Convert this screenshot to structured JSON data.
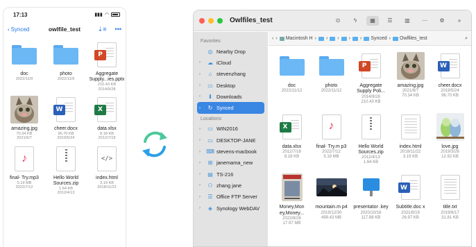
{
  "phone": {
    "status_time": "17:13",
    "back_label": "Synced",
    "title": "owlfile_test",
    "files": [
      {
        "name": "doc",
        "meta": [
          "2022/11/9"
        ],
        "icon": "folder-icon"
      },
      {
        "name": "photo",
        "meta": [
          "2022/11/9"
        ],
        "icon": "folder-icon"
      },
      {
        "name": "Aggregate Supply...ies.pptx",
        "meta": [
          "210.43 KB",
          "2014/9/28"
        ],
        "icon": "powerpoint-icon"
      },
      {
        "name": "amazing.jpg",
        "meta": [
          "70.34 KB",
          "2021/6/7"
        ],
        "icon": "cat-photo-icon"
      },
      {
        "name": "cheer.docx",
        "meta": [
          "96.70 KB",
          "2019/5/24"
        ],
        "icon": "word-icon"
      },
      {
        "name": "data.xlsx",
        "meta": [
          "8.18 KB",
          "2012/7/18"
        ],
        "icon": "excel-icon"
      },
      {
        "name": "final- Try.mp3",
        "meta": [
          "5.19 MB",
          "2022/7/12"
        ],
        "icon": "music-icon"
      },
      {
        "name": "Hello World Sources.zip",
        "meta": [
          "1.64 KB",
          "2012/4/13"
        ],
        "icon": "zip-icon"
      },
      {
        "name": "index.html",
        "meta": [
          "3.19 KB",
          "2018/11/22"
        ],
        "icon": "code-icon"
      }
    ]
  },
  "mac": {
    "window_title": "Owlfiles_test",
    "path": [
      "Macintosh H",
      "",
      "",
      "",
      "",
      "Synced",
      "Owlfiles_test"
    ],
    "sidebar_group_favorites": "Favorites",
    "sidebar_group_locations": "Locations",
    "favorites": [
      {
        "label": "Nearby Drop",
        "icon": "airdrop-icon"
      },
      {
        "label": "iCloud",
        "icon": "cloud-icon",
        "arrow": true
      },
      {
        "label": "stevenzhang",
        "icon": "home-icon",
        "arrow": true
      },
      {
        "label": "Desktop",
        "icon": "desktop-icon",
        "arrow": true
      },
      {
        "label": "Downloads",
        "icon": "download-icon",
        "arrow": true
      },
      {
        "label": "Synced",
        "icon": "sync-icon",
        "arrow": true,
        "active": true
      }
    ],
    "locations": [
      {
        "label": "WIN2016",
        "icon": "monitor-icon",
        "arrow": true
      },
      {
        "label": "DESKTOP-JANE",
        "icon": "monitor-icon",
        "arrow": true
      },
      {
        "label": "stevens-macbook",
        "icon": "laptop-icon",
        "arrow": true
      },
      {
        "label": "janemama_new",
        "icon": "network-icon",
        "arrow": true
      },
      {
        "label": "TS-216",
        "icon": "nas-icon",
        "arrow": true
      },
      {
        "label": "zhang jane",
        "icon": "user-icon",
        "arrow": true
      },
      {
        "label": "Office FTP Server",
        "icon": "server-icon",
        "arrow": true
      },
      {
        "label": "Synology WebDAV",
        "icon": "webdav-icon",
        "arrow": true
      }
    ],
    "files": [
      {
        "name": "doc",
        "meta": [
          "2022/11/12"
        ],
        "icon": "folder-icon"
      },
      {
        "name": "photo",
        "meta": [
          "2022/11/12"
        ],
        "icon": "folder-icon"
      },
      {
        "name": "Aggregate Supply Poli...",
        "meta": [
          "2014/9/28",
          "210.43 KB"
        ],
        "icon": "powerpoint-icon"
      },
      {
        "name": "amazing.jpg",
        "meta": [
          "2021/6/7",
          "70.34 KB"
        ],
        "icon": "cat-photo-icon"
      },
      {
        "name": "cheer.docx",
        "meta": [
          "2019/5/24",
          "96.70 KB"
        ],
        "icon": "word-icon"
      },
      {
        "name": "data.xlsx",
        "meta": [
          "2012/7/18",
          "8.18 KB"
        ],
        "icon": "excel-icon"
      },
      {
        "name": "final- Try.m p3",
        "meta": [
          "2022/7/12",
          "5.19 MB"
        ],
        "icon": "music-icon"
      },
      {
        "name": "Hello World Sources.zip",
        "meta": [
          "2012/4/13",
          "1.64 KB"
        ],
        "icon": "zip-icon"
      },
      {
        "name": "index.html",
        "meta": [
          "2018/11/22",
          "3.19 KB"
        ],
        "icon": "text-doc-icon"
      },
      {
        "name": "love.jpg",
        "meta": [
          "2019/3/26",
          "12.92 KB"
        ],
        "icon": "birds-photo-icon"
      },
      {
        "name": "Money,Mon ey,Money...",
        "meta": [
          "2022/8/26",
          "17.97 MB"
        ],
        "icon": "magazine-icon"
      },
      {
        "name": "mountain.m p4",
        "meta": [
          "2019/12/30",
          "499.43 MB"
        ],
        "icon": "mountain-photo-icon"
      },
      {
        "name": "presentator .key",
        "meta": [
          "2020/10/16",
          "117.88 KB"
        ],
        "icon": "keynote-icon"
      },
      {
        "name": "Subtitle.doc x",
        "meta": [
          "2021/8/19",
          "26.97 KB"
        ],
        "icon": "word-icon"
      },
      {
        "name": "title.txt",
        "meta": [
          "2019/6/17",
          "31.81 KB"
        ],
        "icon": "text-doc-icon"
      }
    ]
  },
  "colors": {
    "accent": "#3a86e3",
    "folder": "#6bb8f5",
    "sync_green": "#4cc89a",
    "sync_blue": "#2aa0e8"
  }
}
